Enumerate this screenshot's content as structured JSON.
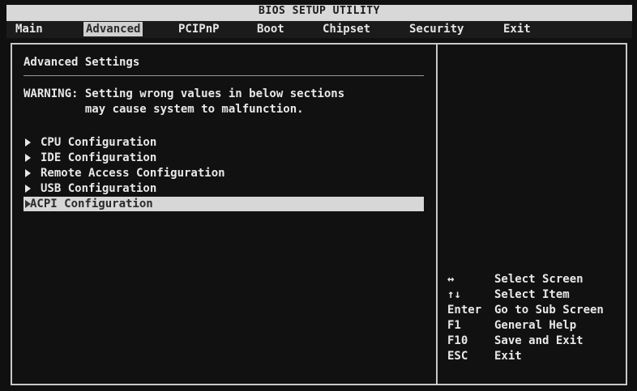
{
  "header": {
    "utility_title": "BIOS SETUP UTILITY",
    "tabs": [
      {
        "label": "Main"
      },
      {
        "label": "Advanced"
      },
      {
        "label": "PCIPnP"
      },
      {
        "label": "Boot"
      },
      {
        "label": "Chipset"
      },
      {
        "label": "Security"
      },
      {
        "label": "Exit"
      }
    ],
    "active_tab": "Advanced"
  },
  "main": {
    "section_title": "Advanced Settings",
    "warning": {
      "line1": "WARNING: Setting wrong values in below sections",
      "line2": "         may cause system to malfunction."
    },
    "items": [
      {
        "label": "CPU Configuration"
      },
      {
        "label": "IDE Configuration"
      },
      {
        "label": "Remote Access Configuration"
      },
      {
        "label": "USB Configuration"
      },
      {
        "label": "ACPI Configuration"
      }
    ],
    "selected_item": "ACPI Configuration"
  },
  "help": {
    "rows": [
      {
        "key": "↔",
        "desc": "Select Screen"
      },
      {
        "key": "↑↓",
        "desc": "Select Item"
      },
      {
        "key": "Enter",
        "desc": "Go to Sub Screen"
      },
      {
        "key": "F1",
        "desc": "General Help"
      },
      {
        "key": "F10",
        "desc": "Save and Exit"
      },
      {
        "key": "ESC",
        "desc": "Exit"
      }
    ]
  },
  "colors": {
    "background": "#101010",
    "foreground": "#e8e8e8",
    "highlight": "#d7d7d7"
  }
}
